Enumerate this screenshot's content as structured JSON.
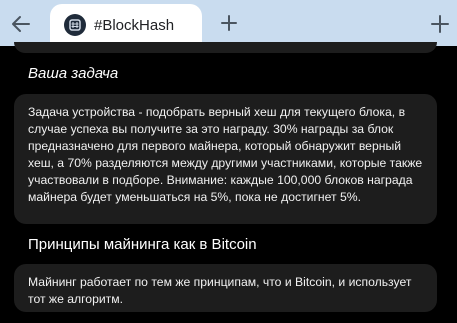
{
  "browser": {
    "tab_title": "#BlockHash",
    "icons": {
      "back": "arrow-left-icon",
      "new_tab": "plus-icon",
      "corner": "expand-corner-icon",
      "favicon": "blockhash-logo-icon"
    }
  },
  "main": {
    "task_heading": "Ваша задача",
    "task_text": "Задача устройства - подобрать верный хеш для текущего блока, в случае успеха вы получите за это награду. 30% награды за блок предназначено для первого майнера, который обнаружит верный хеш, а 70% разделяются между другими участниками, которые также участвовали в подборе. Внимание: каждые 100,000 блоков награда майнера будет уменьшаться на 5%, пока не достигнет 5%.",
    "principles_heading": "Принципы майнинга как в Bitcoin",
    "principles_text": "Майнинг работает по тем же принципам, что и Bitcoin, и использует тот же алгоритм."
  },
  "colors": {
    "tabstrip_bg": "#c9dcef",
    "tab_bg": "#ffffff",
    "page_bg": "#000000",
    "card_bg": "#1d1d1d"
  }
}
